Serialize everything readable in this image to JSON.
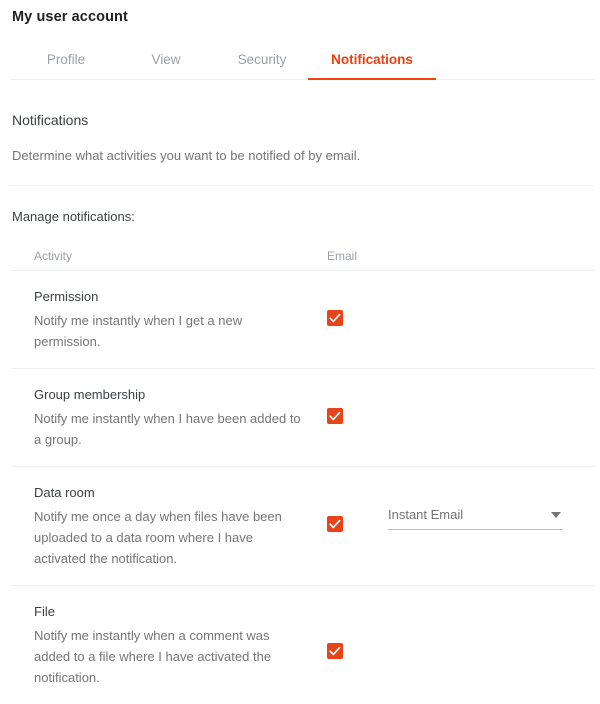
{
  "header": {
    "title": "My user account"
  },
  "tabs": [
    {
      "label": "Profile",
      "active": false
    },
    {
      "label": "View",
      "active": false
    },
    {
      "label": "Security",
      "active": false
    },
    {
      "label": "Notifications",
      "active": true
    }
  ],
  "section": {
    "title": "Notifications",
    "description": "Determine what activities you want to be notified of by email.",
    "manage_label": "Manage notifications:"
  },
  "table": {
    "columns": {
      "activity": "Activity",
      "email": "Email"
    },
    "rows": [
      {
        "title": "Permission",
        "description": "Notify me instantly when I get a new permission.",
        "email_checked": true,
        "has_select": false
      },
      {
        "title": "Group membership",
        "description": "Notify me instantly when I have been added to a group.",
        "email_checked": true,
        "has_select": false
      },
      {
        "title": "Data room",
        "description": "Notify me once a day when files have been uploaded to a data room where I have activated the notification.",
        "email_checked": true,
        "has_select": true,
        "select_value": "Instant Email"
      },
      {
        "title": "File",
        "description": "Notify me instantly when a comment was added to a file where I have activated the notification.",
        "email_checked": true,
        "has_select": false
      }
    ]
  },
  "colors": {
    "accent": "#ea4010",
    "checkbox": "#e8441a",
    "muted_text": "#757575",
    "title_text": "#3c4043",
    "divider": "#eceef0"
  },
  "icons": {
    "check": "check-icon",
    "caret": "chevron-down-icon"
  }
}
